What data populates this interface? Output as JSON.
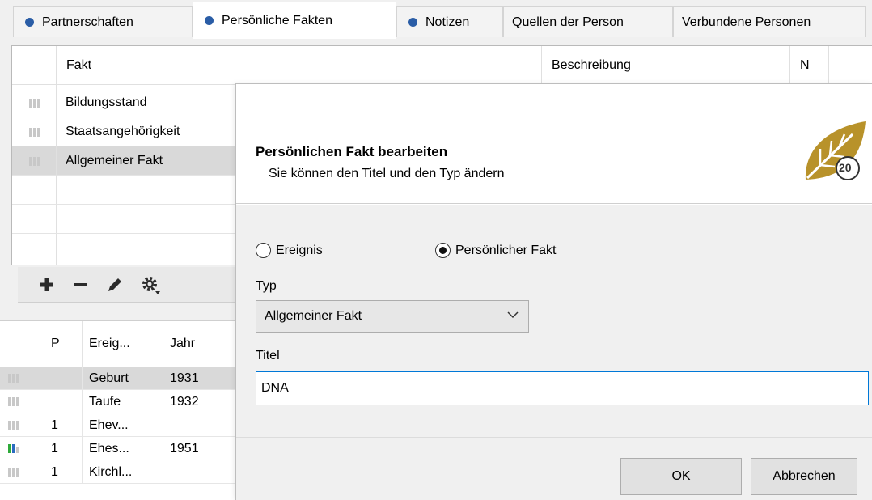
{
  "tabs": [
    {
      "label": "Partnerschaften",
      "dot": true
    },
    {
      "label": "Persönliche Fakten",
      "dot": true,
      "active": true
    },
    {
      "label": "Notizen",
      "dot": true
    },
    {
      "label": "Quellen der Person",
      "dot": false
    },
    {
      "label": "Verbundene Personen",
      "dot": false
    }
  ],
  "facts": {
    "columns": {
      "fakt": "Fakt",
      "beschreibung": "Beschreibung",
      "n": "N"
    },
    "rows": [
      {
        "label": "Bildungsstand"
      },
      {
        "label": "Staatsangehörigkeit"
      },
      {
        "label": "Allgemeiner Fakt",
        "selected": true
      }
    ]
  },
  "toolbar": {
    "icons": [
      "plus-icon",
      "minus-icon",
      "pencil-icon",
      "gear-icon"
    ]
  },
  "events": {
    "columns": {
      "p": "P",
      "ereignis": "Ereig...",
      "jahr": "Jahr"
    },
    "rows": [
      {
        "p": "",
        "ereignis": "Geburt",
        "jahr": "1931",
        "selected": true
      },
      {
        "p": "",
        "ereignis": "Taufe",
        "jahr": "1932"
      },
      {
        "p": "1",
        "ereignis": "Ehev...",
        "jahr": ""
      },
      {
        "p": "1",
        "ereignis": "Ehes...",
        "jahr": "1951",
        "colored": true
      },
      {
        "p": "1",
        "ereignis": "Kirchl...",
        "jahr": ""
      }
    ]
  },
  "dialog": {
    "title": "Persönlichen Fakt bearbeiten",
    "subtitle": "Sie können den Titel und den Typ ändern",
    "logo_text": "20",
    "radio_ereignis": "Ereignis",
    "radio_fakt": "Persönlicher Fakt",
    "selected_radio": "Persönlicher Fakt",
    "typ_label": "Typ",
    "typ_value": "Allgemeiner Fakt",
    "titel_label": "Titel",
    "titel_value": "DNA",
    "ok_label": "OK",
    "cancel_label": "Abbrechen"
  },
  "colors": {
    "tab_dot": "#2a5da6",
    "input_focus": "#0078d7",
    "selection": "#d9d9d9",
    "logo_gold": "#b8922a"
  }
}
